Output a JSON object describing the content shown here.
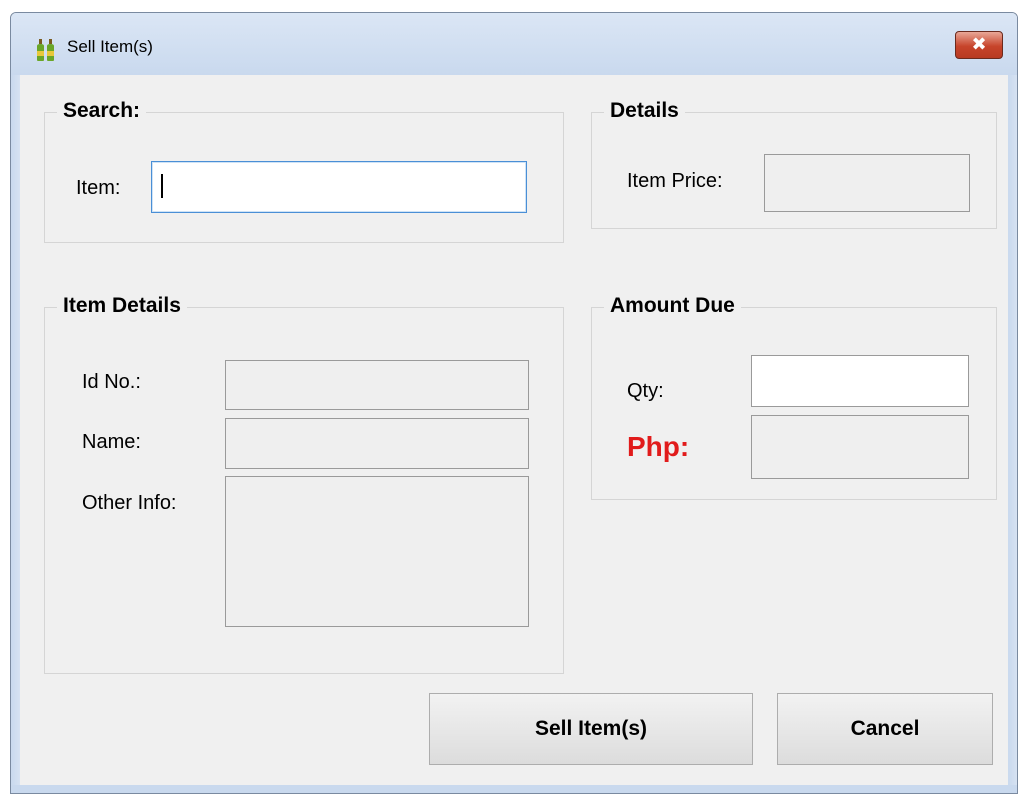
{
  "window": {
    "title": "Sell Item(s)",
    "close_glyph": "✖"
  },
  "search": {
    "legend": "Search:",
    "item_label": "Item:",
    "item_value": ""
  },
  "details": {
    "legend": "Details",
    "price_label": "Item Price:",
    "price_value": ""
  },
  "item_details": {
    "legend": "Item Details",
    "id_label": "Id No.:",
    "id_value": "",
    "name_label": "Name:",
    "name_value": "",
    "other_label": "Other Info:",
    "other_value": ""
  },
  "amount_due": {
    "legend": "Amount Due",
    "qty_label": "Qty:",
    "qty_value": "",
    "php_label": "Php:",
    "php_value": ""
  },
  "buttons": {
    "sell": "Sell Item(s)",
    "cancel": "Cancel"
  },
  "colors": {
    "php_accent": "#e11b1b",
    "focus_border": "#4a8fd6",
    "close_button": "#c7442b"
  },
  "icons": {
    "app": "bottles-icon",
    "close": "close-icon"
  }
}
